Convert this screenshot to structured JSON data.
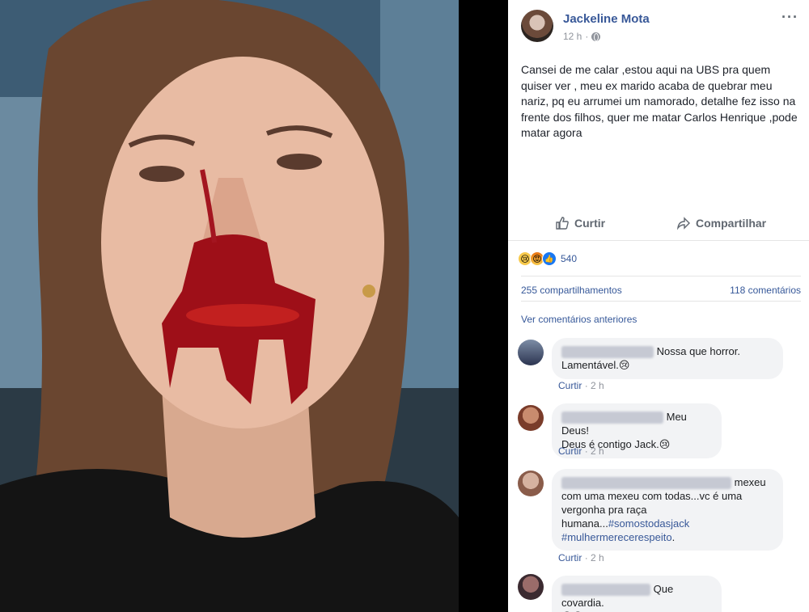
{
  "post": {
    "author": "Jackeline Mota",
    "time": "12 h",
    "visibility_icon": "globe-icon",
    "text": "Cansei de me calar ,estou aqui na UBS pra quem quiser ver , meu ex marido acaba de quebrar meu nariz, pq eu arrumei um namorado, detalhe fez isso na frente dos filhos, quer me matar Carlos Henrique ,pode matar agora"
  },
  "actions": {
    "like_label": "Curtir",
    "share_label": "Compartilhar"
  },
  "reactions": {
    "count": "540",
    "types": [
      "sad",
      "angry",
      "like"
    ]
  },
  "stats": {
    "shares": "255 compartilhamentos",
    "comments": "118 comentários"
  },
  "prev_comments_label": "Ver comentários anteriores",
  "comments": [
    {
      "text_line1": "Nossa que horror.",
      "text_line2": "Lamentável.",
      "emoji": "😢",
      "like_label": "Curtir",
      "time": "2 h"
    },
    {
      "text_line1": "Meu Deus!",
      "text_line2": "Deus é contigo Jack.",
      "emoji": "😢",
      "like_label": "Curtir",
      "time": "2 h"
    },
    {
      "text_line1": "mexeu",
      "text_line2": "com uma mexeu com todas...vc é uma",
      "text_line3": "vergonha pra raça",
      "text_line4": "humana...",
      "hashtag1": "#somostodasjack",
      "hashtag2": "#mulhermerecerespeito",
      "hashtag2_suffix": ".",
      "like_label": "Curtir",
      "time": "2 h"
    },
    {
      "text_line1": "Que covardia.",
      "emoji": "😢😢"
    }
  ],
  "colors": {
    "link": "#385898",
    "muted": "#90949c",
    "bubble": "#f2f3f5"
  }
}
